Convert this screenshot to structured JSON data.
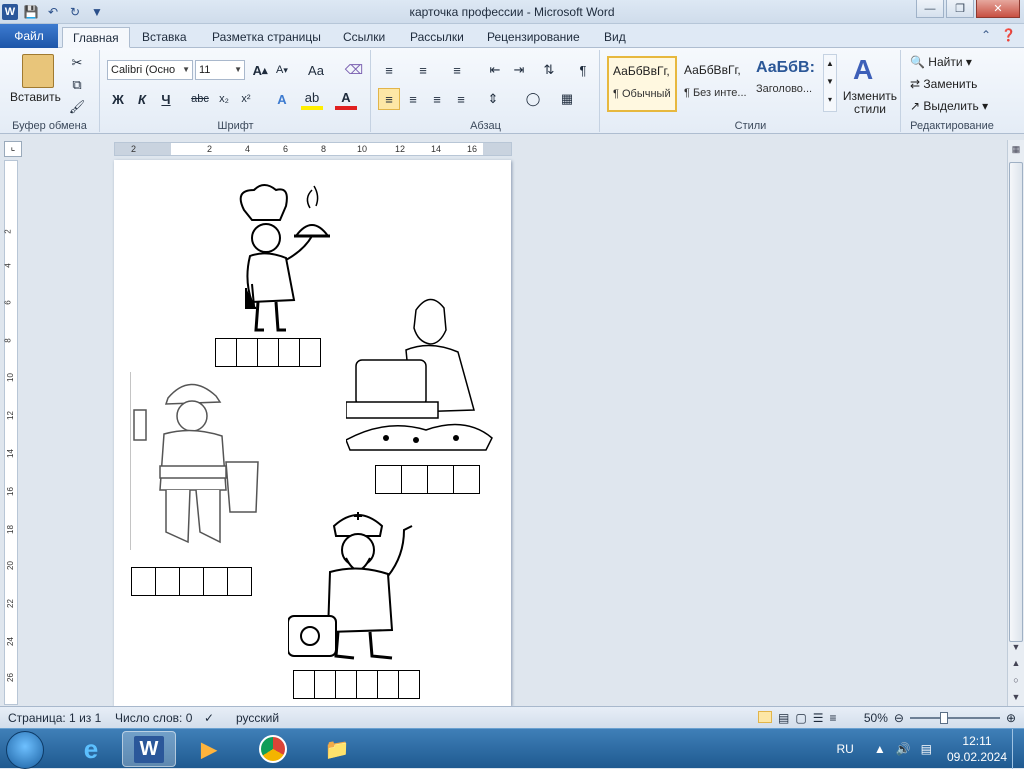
{
  "window": {
    "title": "карточка профессии - Microsoft Word"
  },
  "tabs": [
    "Главная",
    "Вставка",
    "Разметка страницы",
    "Ссылки",
    "Рассылки",
    "Рецензирование",
    "Вид"
  ],
  "file_tab": "Файл",
  "ribbon": {
    "clipboard": {
      "paste": "Вставить",
      "label": "Буфер обмена"
    },
    "font": {
      "name": "Calibri (Осно",
      "size": "11",
      "label": "Шрифт"
    },
    "paragraph": {
      "label": "Абзац"
    },
    "styles": {
      "items": [
        {
          "preview": "АаБбВвГг,",
          "name": "¶ Обычный"
        },
        {
          "preview": "АаБбВвГг,",
          "name": "¶ Без инте..."
        },
        {
          "preview": "АаБбВ:",
          "name": "Заголово..."
        }
      ],
      "change": "Изменить стили",
      "label": "Стили"
    },
    "editing": {
      "find": "Найти",
      "replace": "Заменить",
      "select": "Выделить",
      "label": "Редактирование"
    }
  },
  "ruler": {
    "h_ticks": [
      "2",
      "2",
      "4",
      "6",
      "8",
      "10",
      "12",
      "14",
      "16"
    ],
    "v_ticks": [
      "2",
      "4",
      "6",
      "8",
      "10",
      "12",
      "14",
      "16",
      "18",
      "20",
      "22",
      "24",
      "26"
    ]
  },
  "document": {
    "answer_boxes": [
      {
        "count": 5
      },
      {
        "count": 4
      },
      {
        "count": 5
      },
      {
        "count": 6
      }
    ]
  },
  "status": {
    "page": "Страница: 1 из 1",
    "words": "Число слов: 0",
    "language": "русский",
    "zoom": "50%"
  },
  "taskbar": {
    "lang": "RU",
    "time": "12:11",
    "date": "09.02.2024"
  }
}
